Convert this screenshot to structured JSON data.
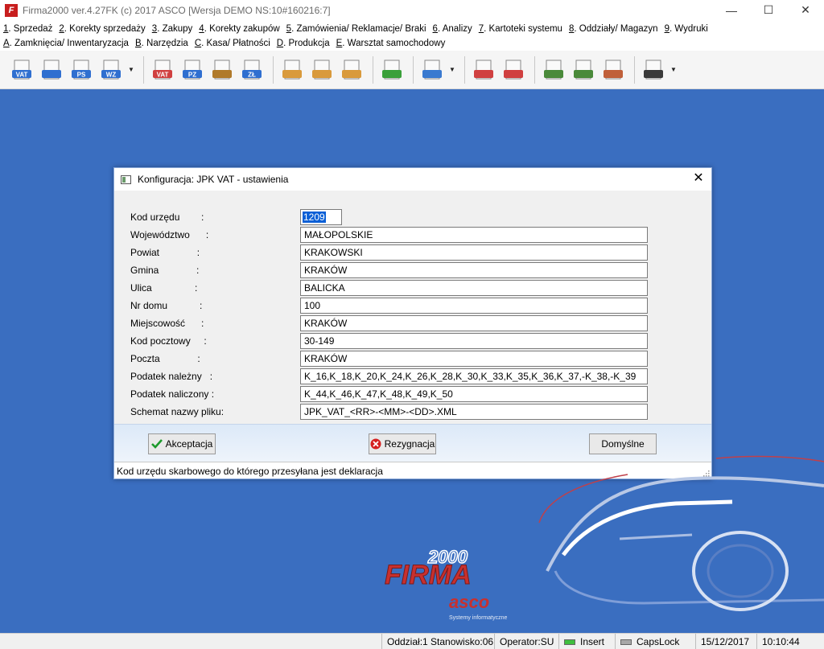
{
  "window": {
    "title": "Firma2000 ver.4.27FK  (c) 2017 ASCO  [Wersja DEMO NS:10#160216:7]",
    "app_icon_letter": "F",
    "minimize": "—",
    "maximize": "☐",
    "close": "✕"
  },
  "menu": {
    "row1": [
      {
        "key": "1",
        "label": ". Sprzedaż"
      },
      {
        "key": "2",
        "label": ". Korekty sprzedaży"
      },
      {
        "key": "3",
        "label": ". Zakupy"
      },
      {
        "key": "4",
        "label": ". Korekty zakupów"
      },
      {
        "key": "5",
        "label": ". Zamówienia/ Reklamacje/ Braki"
      },
      {
        "key": "6",
        "label": ". Analizy"
      },
      {
        "key": "7",
        "label": ". Kartoteki systemu"
      },
      {
        "key": "8",
        "label": ". Oddziały/ Magazyn"
      },
      {
        "key": "9",
        "label": ". Wydruki"
      }
    ],
    "row2": [
      {
        "key": "A",
        "label": ". Zamknięcia/ Inwentaryzacja"
      },
      {
        "key": "B",
        "label": ". Narzędzia"
      },
      {
        "key": "C",
        "label": ". Kasa/ Płatności"
      },
      {
        "key": "D",
        "label": ". Produkcja"
      },
      {
        "key": "E",
        "label": ". Warsztat samochodowy"
      }
    ]
  },
  "toolbar": {
    "buttons": [
      {
        "icon": "vat-invoice-icon",
        "text": "VAT",
        "color": "#2f6fd0"
      },
      {
        "icon": "document-arrow-icon",
        "text": "",
        "color": "#2f6fd0"
      },
      {
        "icon": "ps-document-icon",
        "text": "PS",
        "color": "#2f6fd0"
      },
      {
        "icon": "wz-document-icon",
        "text": "WZ",
        "color": "#2f6fd0"
      },
      {
        "icon": "vat-purchase-icon",
        "text": "VAT",
        "color": "#d04040"
      },
      {
        "icon": "pz-document-icon",
        "text": "PZ",
        "color": "#2f6fd0"
      },
      {
        "icon": "handcart-icon",
        "text": "",
        "color": "#b07a2a"
      },
      {
        "icon": "zl-document-icon",
        "text": "ZŁ",
        "color": "#2f6fd0"
      },
      {
        "icon": "box-icon",
        "text": "",
        "color": "#d99a3c"
      },
      {
        "icon": "boxes-icon",
        "text": "",
        "color": "#d99a3c"
      },
      {
        "icon": "delivery-box-icon",
        "text": "",
        "color": "#d99a3c"
      },
      {
        "icon": "checklist-icon",
        "text": "",
        "color": "#3aa03a"
      },
      {
        "icon": "basket-search-icon",
        "text": "",
        "color": "#3a7ad0"
      },
      {
        "icon": "truck-alert-icon",
        "text": "",
        "color": "#d04040"
      },
      {
        "icon": "cart-warning-icon",
        "text": "",
        "color": "#d04040"
      },
      {
        "icon": "users-icon",
        "text": "",
        "color": "#4a8a3a"
      },
      {
        "icon": "users-key-icon",
        "text": "",
        "color": "#4a8a3a"
      },
      {
        "icon": "truck-icon",
        "text": "",
        "color": "#c0603a"
      },
      {
        "icon": "user-icon",
        "text": "",
        "color": "#3a3a3a"
      }
    ],
    "dropdown_glyph": "▼"
  },
  "dialog": {
    "title": "Konfiguracja: JPK VAT - ustawienia",
    "close": "✕",
    "fields": [
      {
        "label": "Kod urzędu        :",
        "value": "1209"
      },
      {
        "label": "Województwo      :",
        "value": "MAŁOPOLSKIE"
      },
      {
        "label": "Powiat              :",
        "value": "KRAKOWSKI"
      },
      {
        "label": "Gmina              :",
        "value": "KRAKÓW"
      },
      {
        "label": "Ulica                :",
        "value": "BALICKA"
      },
      {
        "label": "Nr domu            :",
        "value": "100"
      },
      {
        "label": "Miejscowość      :",
        "value": "KRAKÓW"
      },
      {
        "label": "Kod pocztowy     :",
        "value": "30-149"
      },
      {
        "label": "Poczta              :",
        "value": "KRAKÓW"
      },
      {
        "label": "Podatek należny   :",
        "value": "K_16,K_18,K_20,K_24,K_26,K_28,K_30,K_33,K_35,K_36,K_37,-K_38,-K_39"
      },
      {
        "label": "Podatek naliczony :",
        "value": "K_44,K_46,K_47,K_48,K_49,K_50"
      },
      {
        "label": "Schemat nazwy pliku:",
        "value": "JPK_VAT_<RR>-<MM>-<DD>.XML"
      }
    ],
    "buttons": {
      "accept": "Akceptacja",
      "cancel": "Rezygnacja",
      "defaults": "Domyślne"
    },
    "hint": "Kod urzędu skarbowego do którego przesyłana jest deklaracja"
  },
  "logo": {
    "number": "2000",
    "brand": "FIRMA",
    "company": "asco",
    "tagline": "Systemy informatyczne"
  },
  "statusbar": {
    "location": "Oddział:1 Stanowisko:06",
    "operator": "Operator:SU",
    "insert": "Insert",
    "capslock": "CapsLock",
    "date": "15/12/2017",
    "time": "10:10:44",
    "insert_led_color": "#3fbf3f",
    "capslock_led_color": "#a8a8a8"
  }
}
